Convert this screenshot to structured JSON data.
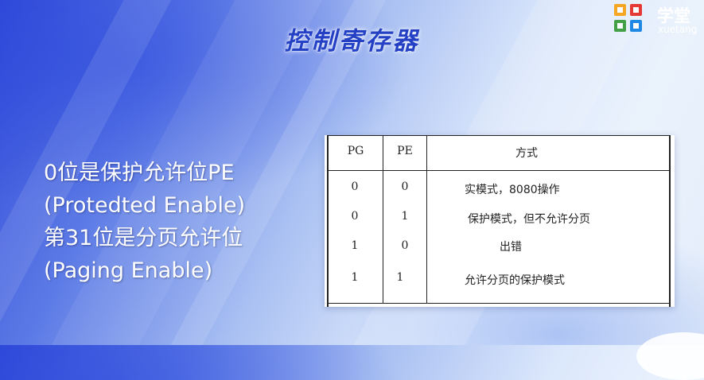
{
  "slide": {
    "title": "控制寄存器",
    "lines": [
      "0位是保护允许位PE",
      "(Protedted Enable)",
      "第31位是分页允许位",
      "(Paging Enable)"
    ]
  },
  "logo": {
    "name": "学堂",
    "subtitle": "xuetang",
    "colors": [
      "#f5a623",
      "#e53935",
      "#43a047",
      "#1e88e5"
    ]
  },
  "table": {
    "headers": [
      "PG",
      "PE",
      "方式"
    ],
    "rows": [
      [
        "0",
        "0",
        "实模式，8080操作"
      ],
      [
        "0",
        "1",
        "保护模式，但不允许分页"
      ],
      [
        "",
        "",
        "出错"
      ],
      [
        "1",
        "0",
        ""
      ],
      [
        "1",
        "1",
        "允许分页的保护模式"
      ]
    ]
  }
}
